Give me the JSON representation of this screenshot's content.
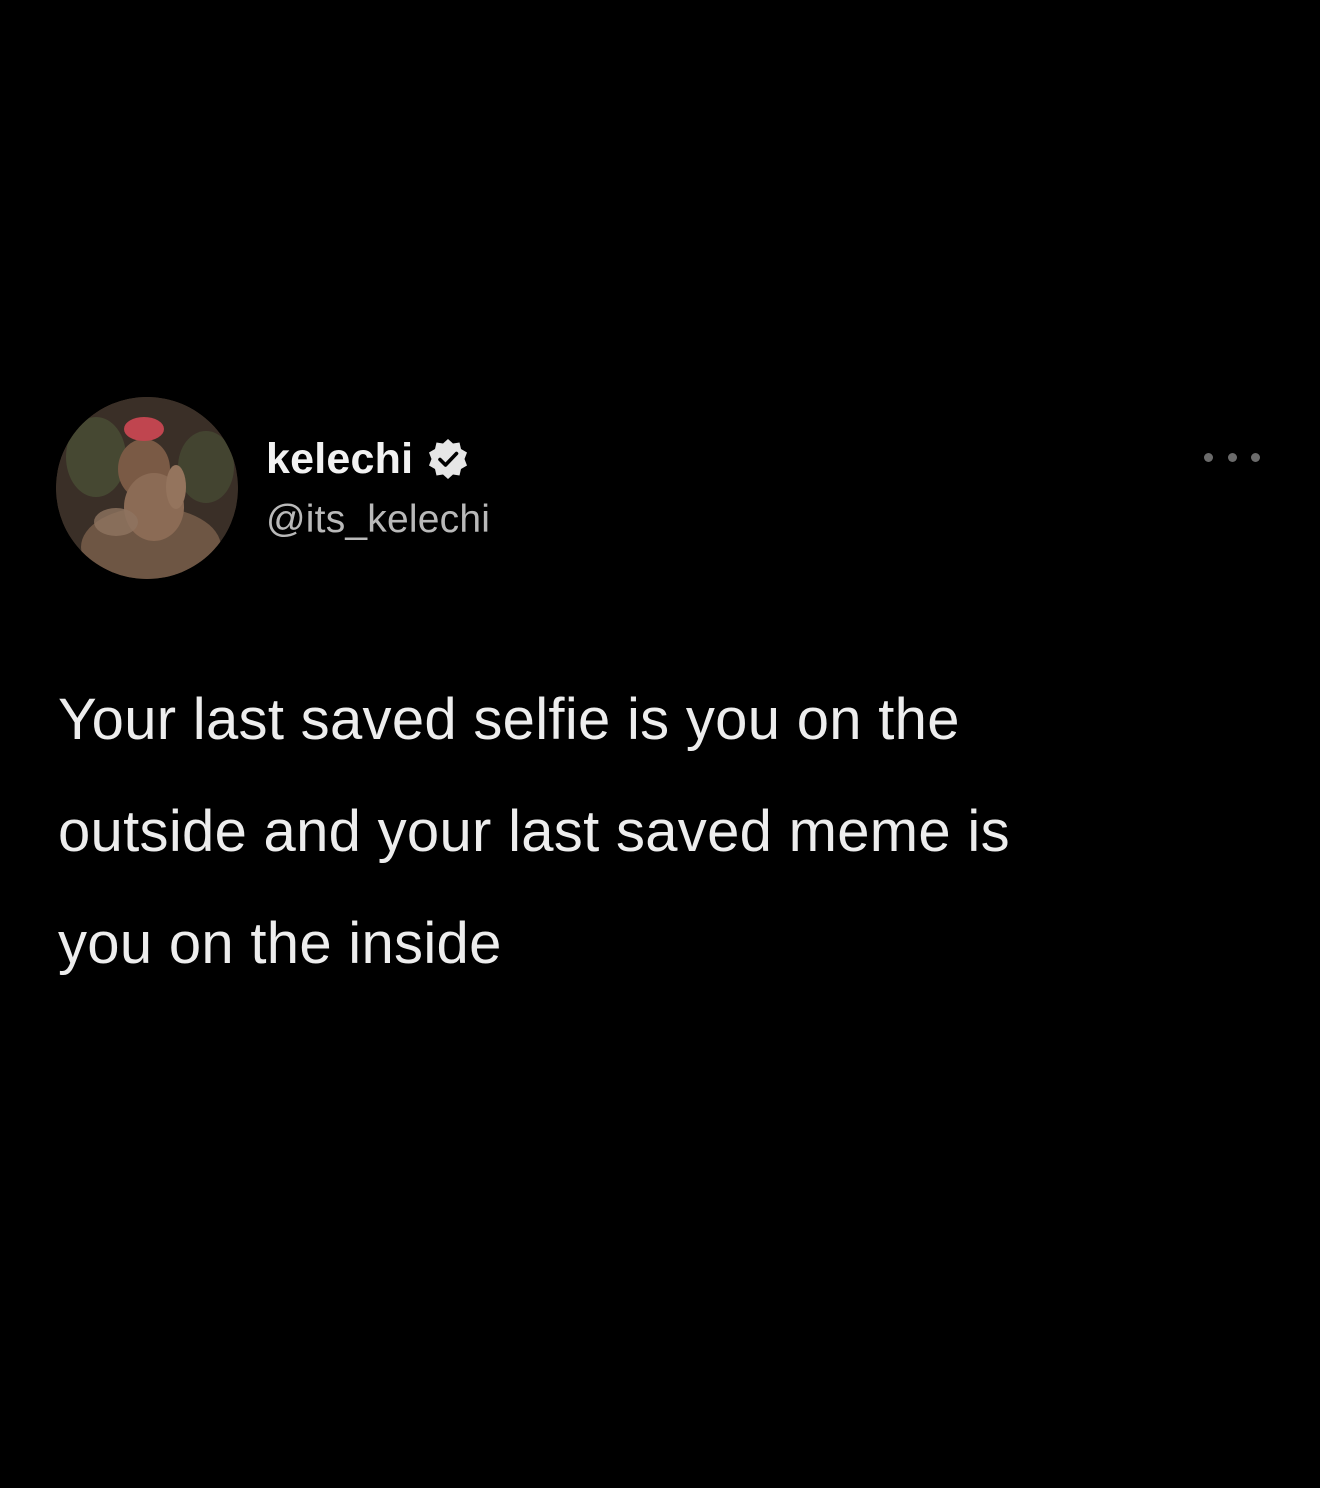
{
  "tweet": {
    "author": {
      "display_name": "kelechi",
      "handle": "@its_kelechi",
      "verified": true,
      "avatar_icon": "profile-photo"
    },
    "more_icon": "more-horizontal-icon",
    "text_lines": [
      "Your last saved selfie is you on the",
      "outside and your last saved meme is",
      "you on the inside"
    ]
  },
  "colors": {
    "background": "#000000",
    "text": "#ededed",
    "handle": "#b9b9b9"
  }
}
